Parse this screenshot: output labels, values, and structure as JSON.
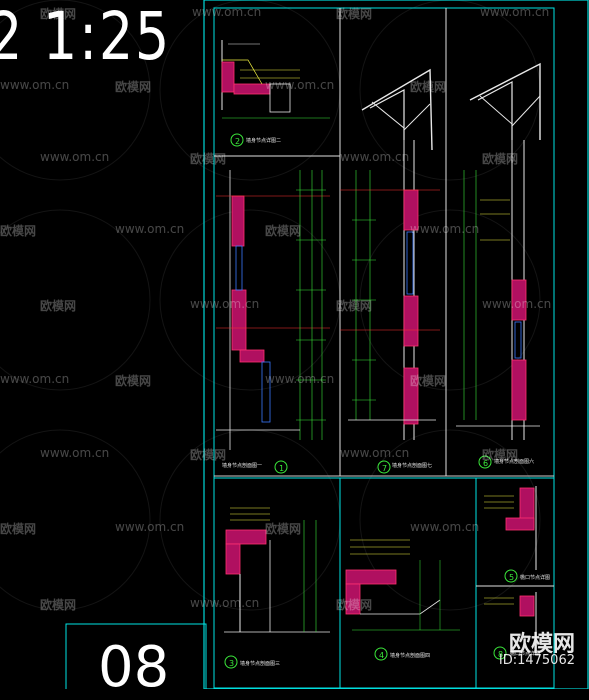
{
  "clock": {
    "text": "2 1:25"
  },
  "page_number": {
    "text": "08"
  },
  "watermark": {
    "site": "www.om.cn",
    "brand": "欧模网"
  },
  "brand_logo": {
    "name": "欧模网",
    "id": "ID:1475062"
  },
  "drawings": [
    {
      "num": "2",
      "label": "墙身节点详图二"
    },
    {
      "num": "1",
      "label": "墙身节点剖面图一"
    },
    {
      "num": "7",
      "label": "墙身节点剖面图七"
    },
    {
      "num": "6",
      "label": "墙身节点剖面图六"
    },
    {
      "num": "3",
      "label": "墙身节点剖面图三"
    },
    {
      "num": "4",
      "label": "墙身节点剖面图四"
    },
    {
      "num": "5",
      "label": "檐口节点详图"
    },
    {
      "num": "8",
      "label": "檐口节点详图"
    }
  ],
  "colors": {
    "frame": "#00e5e5",
    "wall_fill": "#b01060",
    "wall_edge": "#ff3070",
    "dimension": "#3ae63a",
    "note": "#f0f040",
    "steel": "#e8e8e8"
  }
}
